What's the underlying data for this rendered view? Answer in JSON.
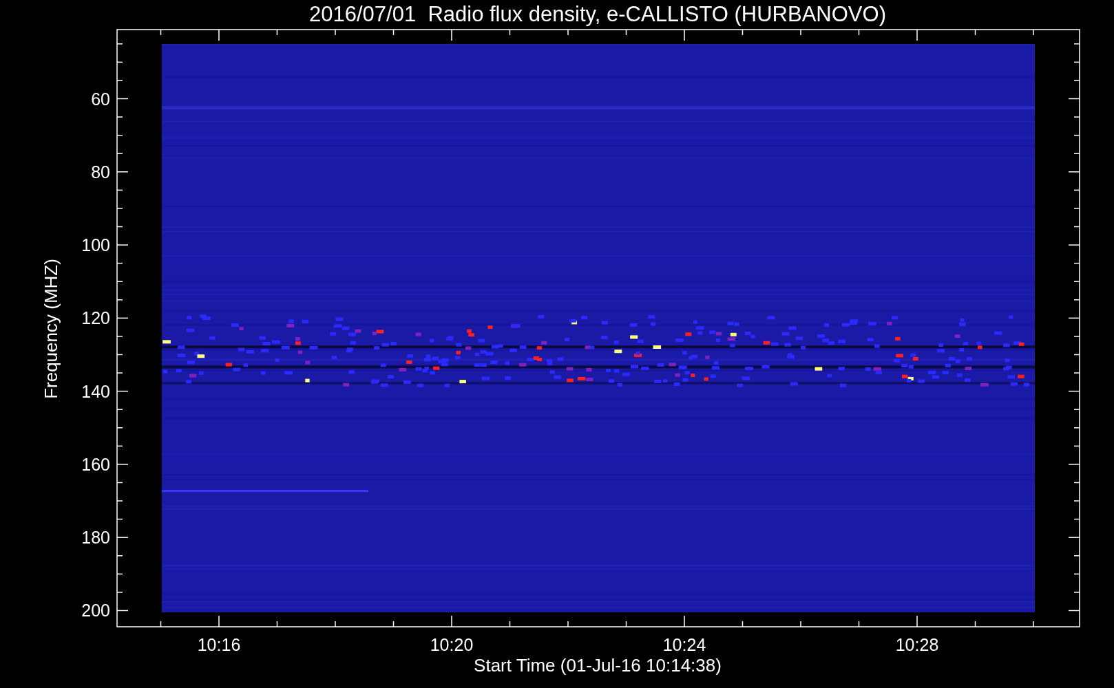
{
  "title": "2016/07/01  Radio flux density, e-CALLISTO (HURBANOVO)",
  "y_axis": {
    "label": "Frequency (MHZ)",
    "ticks": [
      "60",
      "80",
      "100",
      "120",
      "140",
      "160",
      "180",
      "200"
    ]
  },
  "x_axis": {
    "label": "Start Time (01-Jul-16 10:14:38)",
    "ticks": [
      "10:16",
      "10:20",
      "10:24",
      "10:28"
    ]
  }
}
